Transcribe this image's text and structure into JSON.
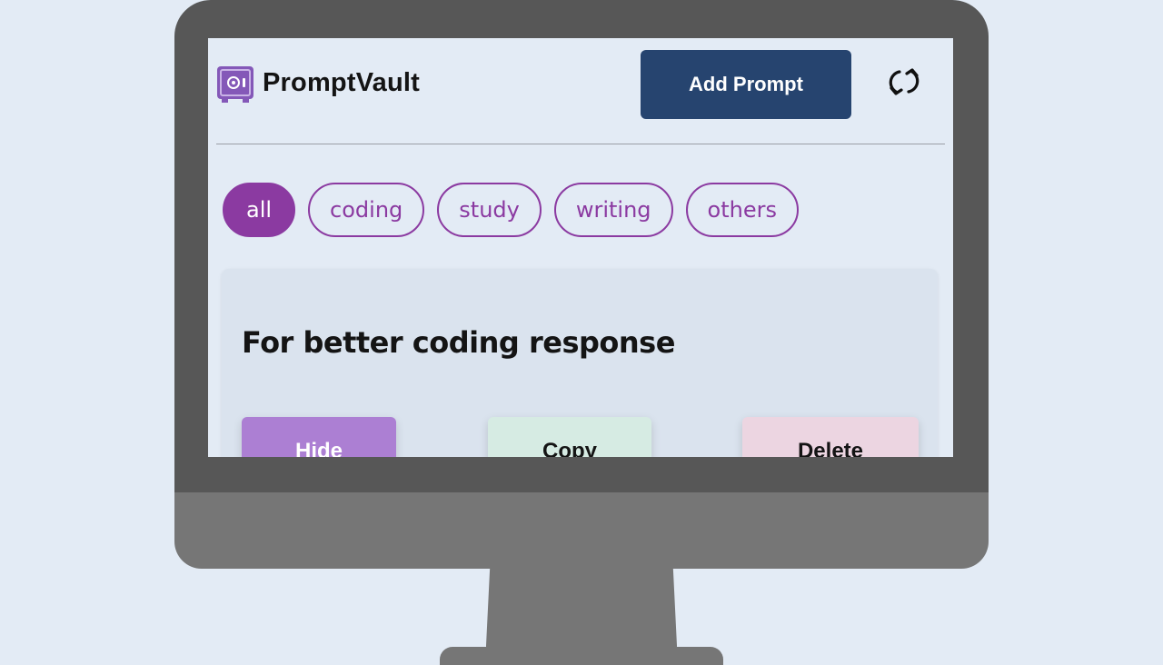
{
  "header": {
    "app_name": "PromptVault",
    "add_button_label": "Add Prompt"
  },
  "filters": [
    {
      "label": "all",
      "active": true
    },
    {
      "label": "coding",
      "active": false
    },
    {
      "label": "study",
      "active": false
    },
    {
      "label": "writing",
      "active": false
    },
    {
      "label": "others",
      "active": false
    }
  ],
  "card": {
    "title": "For better coding response",
    "hide_label": "Hide",
    "copy_label": "Copy",
    "delete_label": "Delete"
  },
  "icons": {
    "logo": "safe-vault-icon",
    "refresh": "refresh-icon"
  },
  "colors": {
    "accent": "#8b3aa1",
    "primary_button": "#26446f",
    "hide_button": "#ac7fd3",
    "copy_button": "#d6ebe3",
    "delete_button": "#ecd5e1",
    "background": "#e3ebf5"
  }
}
